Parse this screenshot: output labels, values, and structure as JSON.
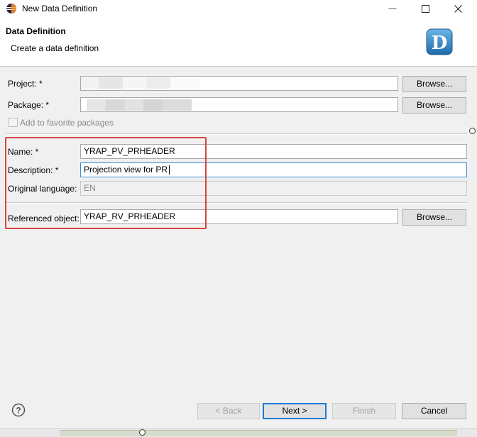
{
  "window": {
    "title": "New Data Definition",
    "minimize_glyph": "—",
    "maximize_glyph": "☐",
    "close_glyph": "✕",
    "icon": "eclipse-icon"
  },
  "header": {
    "title": "Data Definition",
    "subtitle": "Create a data definition",
    "logo_letter": "D",
    "logo_icon": "data-definition-logo-icon"
  },
  "project": {
    "label": "Project: *",
    "browse_label": "Browse..."
  },
  "package": {
    "label": "Package: *",
    "browse_label": "Browse...",
    "favorite_label": "Add to favorite packages"
  },
  "name": {
    "label": "Name: *",
    "value": "YRAP_PV_PRHEADER"
  },
  "description": {
    "label": "Description: *",
    "value": "Projection view for PR"
  },
  "original_language": {
    "label": "Original language:",
    "value": "EN"
  },
  "referenced_object": {
    "label": "Referenced object:",
    "value": "YRAP_RV_PRHEADER",
    "browse_label": "Browse..."
  },
  "footer": {
    "help_glyph": "?",
    "back_label": "< Back",
    "next_label": "Next >",
    "finish_label": "Finish",
    "cancel_label": "Cancel"
  },
  "colors": {
    "highlight_border": "#d9423f",
    "focus_border": "#3b8fd8",
    "default_button_border": "#1e79d6",
    "logo_blue": "#2f7fc1"
  }
}
